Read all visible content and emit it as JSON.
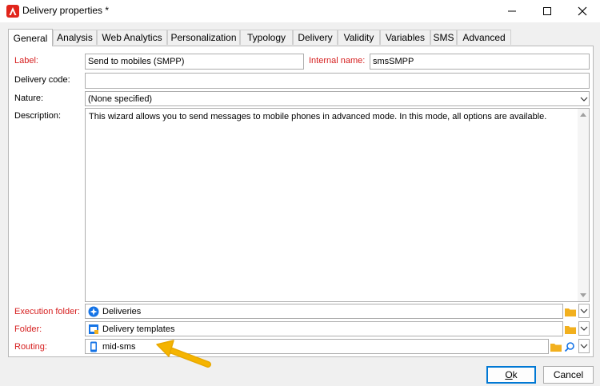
{
  "window": {
    "title": "Delivery properties *",
    "icon": "adobe-campaign-icon"
  },
  "tabs": [
    {
      "label": "General",
      "active": true
    },
    {
      "label": "Analysis"
    },
    {
      "label": "Web Analytics"
    },
    {
      "label": "Personalization"
    },
    {
      "label": "Typology"
    },
    {
      "label": "Delivery"
    },
    {
      "label": "Validity"
    },
    {
      "label": "Variables"
    },
    {
      "label": "SMS"
    },
    {
      "label": "Advanced"
    }
  ],
  "form": {
    "label_label": "Label:",
    "label_value": "Send to mobiles (SMPP)",
    "internal_name_label": "Internal name:",
    "internal_name_value": "smsSMPP",
    "delivery_code_label": "Delivery code:",
    "delivery_code_value": "",
    "nature_label": "Nature:",
    "nature_value": "(None specified)",
    "description_label": "Description:",
    "description_value": "This wizard allows you to send messages to mobile phones in advanced mode. In this mode, all options are available.",
    "execution_folder_label": "Execution folder:",
    "execution_folder_value": "Deliveries",
    "folder_label": "Folder:",
    "folder_value": "Delivery templates",
    "routing_label": "Routing:",
    "routing_value": "mid-sms"
  },
  "buttons": {
    "ok_accel": "O",
    "ok_rest": "k",
    "cancel": "Cancel"
  },
  "colors": {
    "required_label": "#d62020",
    "folder_icon": "#f2b01e",
    "accent": "#0078d4",
    "arrow": "#f5b400"
  }
}
